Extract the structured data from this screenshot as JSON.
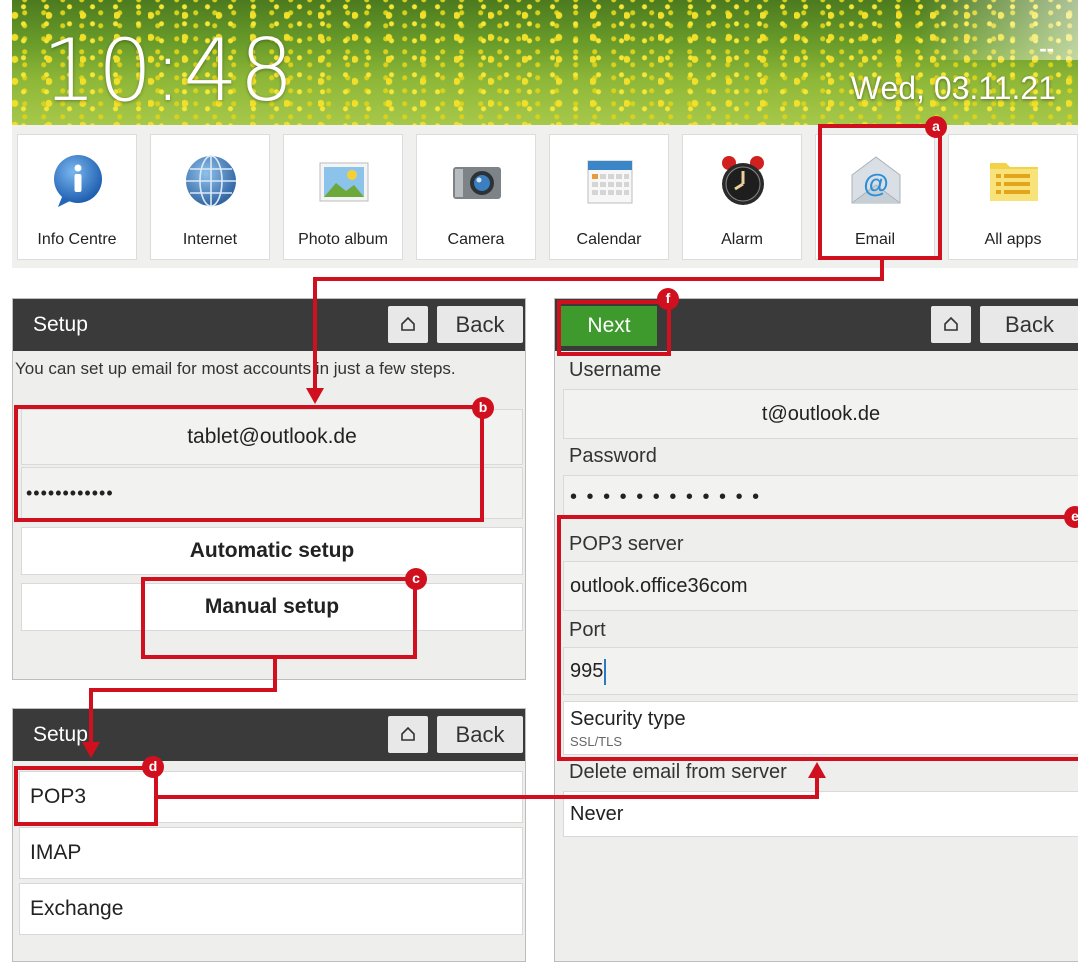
{
  "home": {
    "time": "10:48",
    "date": "Wed, 03.11.21",
    "status": "--",
    "apps": [
      {
        "label": "Info Centre",
        "icon": "info-icon"
      },
      {
        "label": "Internet",
        "icon": "globe-icon"
      },
      {
        "label": "Photo album",
        "icon": "photo-icon"
      },
      {
        "label": "Camera",
        "icon": "camera-icon"
      },
      {
        "label": "Calendar",
        "icon": "calendar-icon"
      },
      {
        "label": "Alarm",
        "icon": "alarm-clock-icon"
      },
      {
        "label": "Email",
        "icon": "email-at-icon"
      },
      {
        "label": "All apps",
        "icon": "list-icon"
      }
    ]
  },
  "setup1": {
    "title": "Setup",
    "back": "Back",
    "intro": "You can set up email for most accounts in just a few steps.",
    "email_value": "tablet@outlook.de",
    "password_value": "••••••••••••",
    "automatic": "Automatic setup",
    "manual": "Manual setup"
  },
  "setup2": {
    "title": "Setup",
    "back": "Back",
    "options": [
      "POP3",
      "IMAP",
      "Exchange"
    ]
  },
  "account": {
    "next": "Next",
    "back": "Back",
    "username_label": "Username",
    "username_value": "t@outlook.de",
    "password_label": "Password",
    "password_value": "• • • • • • • • • • • •",
    "server_label": "POP3 server",
    "server_value": "outlook.office36com",
    "port_label": "Port",
    "port_value": "995",
    "security_label": "Security type",
    "security_value": "SSL/TLS",
    "delete_label": "Delete email from server",
    "delete_value": "Never"
  },
  "callouts": [
    "a",
    "b",
    "c",
    "d",
    "e",
    "f"
  ],
  "colors": {
    "annotation": "#d0101e",
    "titlebar": "#3a3a3a",
    "next_button": "#3e9a2c"
  }
}
